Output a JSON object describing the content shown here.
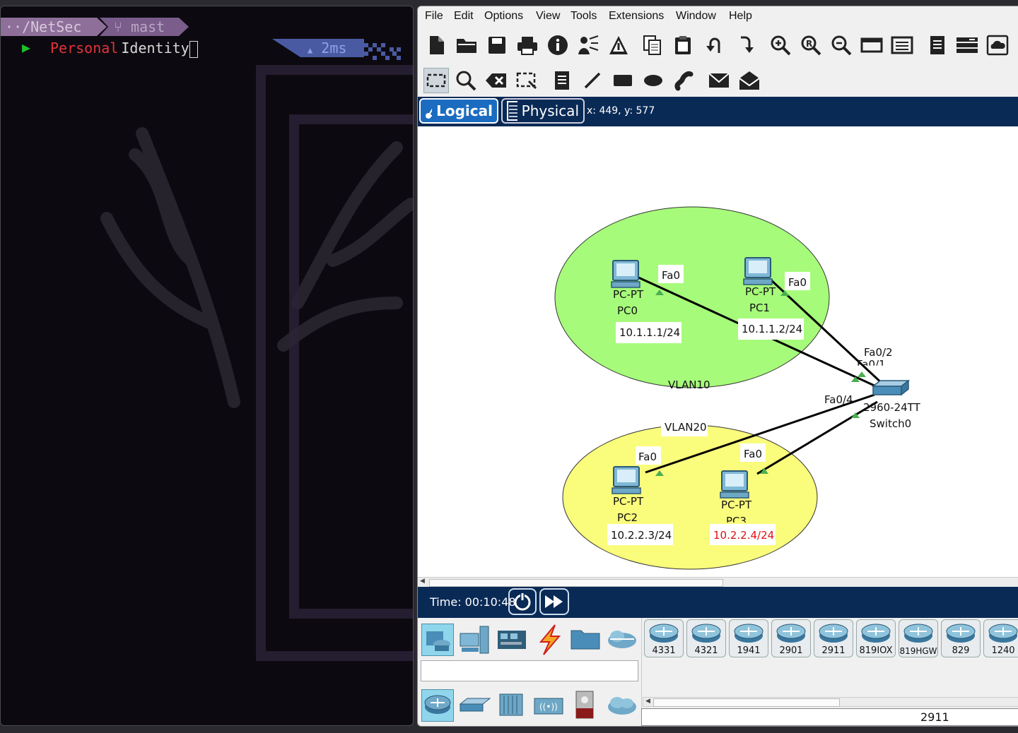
{
  "terminal": {
    "path": "··/NetSec",
    "branch_icon": "git-branch-icon",
    "branch": "mast",
    "prompt_symbol": "chevron-right-icon",
    "word1": "Personal",
    "word2": "Identity",
    "duration_icon": "triangle-up-icon",
    "duration": "2ms"
  },
  "packet_tracer": {
    "menu": [
      "File",
      "Edit",
      "Options",
      "View",
      "Tools",
      "Extensions",
      "Window",
      "Help"
    ],
    "toolbar1_icons": [
      "new-icon",
      "open-icon",
      "save-icon",
      "print-icon",
      "info-icon",
      "activity-wizard-icon",
      "network-info-icon",
      "copy-icon",
      "paste-icon",
      "undo-icon",
      "redo-icon",
      "zoom-in-icon",
      "zoom-reset-icon",
      "zoom-out-icon",
      "drawing-palette-icon",
      "custom-device-icon",
      "pdu-list-icon",
      "view-command-log-icon",
      "cloud-icon"
    ],
    "toolbar2_icons": [
      "select-icon",
      "inspect-icon",
      "delete-icon",
      "resize-icon",
      "note-icon",
      "line-icon",
      "rectangle-icon",
      "ellipse-icon",
      "freeform-icon",
      "simple-pdu-icon",
      "complex-pdu-icon"
    ],
    "tabs": {
      "logical": "Logical",
      "physical": "Physical"
    },
    "coordinates": "x: 449, y: 577",
    "topology": {
      "vlan10_label": "VLAN10",
      "vlan20_label": "VLAN20",
      "vlan10_color": "#a6fb7a",
      "vlan20_color": "#fafc7c",
      "devices": [
        {
          "type": "PC-PT",
          "name": "PC0",
          "ip": "10.1.1.1/24",
          "port": "Fa0"
        },
        {
          "type": "PC-PT",
          "name": "PC1",
          "ip": "10.1.1.2/24",
          "port": "Fa0"
        },
        {
          "type": "PC-PT",
          "name": "PC2",
          "ip": "10.2.2.3/24",
          "port": "Fa0"
        },
        {
          "type": "PC-PT",
          "name": "PC3",
          "ip": "10.2.2.4/24",
          "port": "Fa0",
          "ip_color": "#e01010"
        }
      ],
      "switch": {
        "model": "2960-24TT",
        "name": "Switch0",
        "ports": [
          "Fa0/1",
          "Fa0/2",
          "Fa0/4"
        ]
      }
    },
    "time": "Time: 00:10:48",
    "time_controls": [
      "power-cycle-icon",
      "fast-forward-icon"
    ],
    "device_categories_top": [
      "network-devices-icon",
      "end-devices-icon",
      "components-icon",
      "connections-icon",
      "miscellaneous-icon",
      "multiuser-icon"
    ],
    "device_categories_bottom": [
      "routers-icon",
      "switches-icon",
      "hubs-icon",
      "wireless-devices-icon",
      "security-icon",
      "wan-emulation-icon"
    ],
    "routers": [
      "4331",
      "4321",
      "1941",
      "2901",
      "2911",
      "819IOX",
      "819HGW",
      "829",
      "1240"
    ],
    "selected_model": "2911"
  }
}
